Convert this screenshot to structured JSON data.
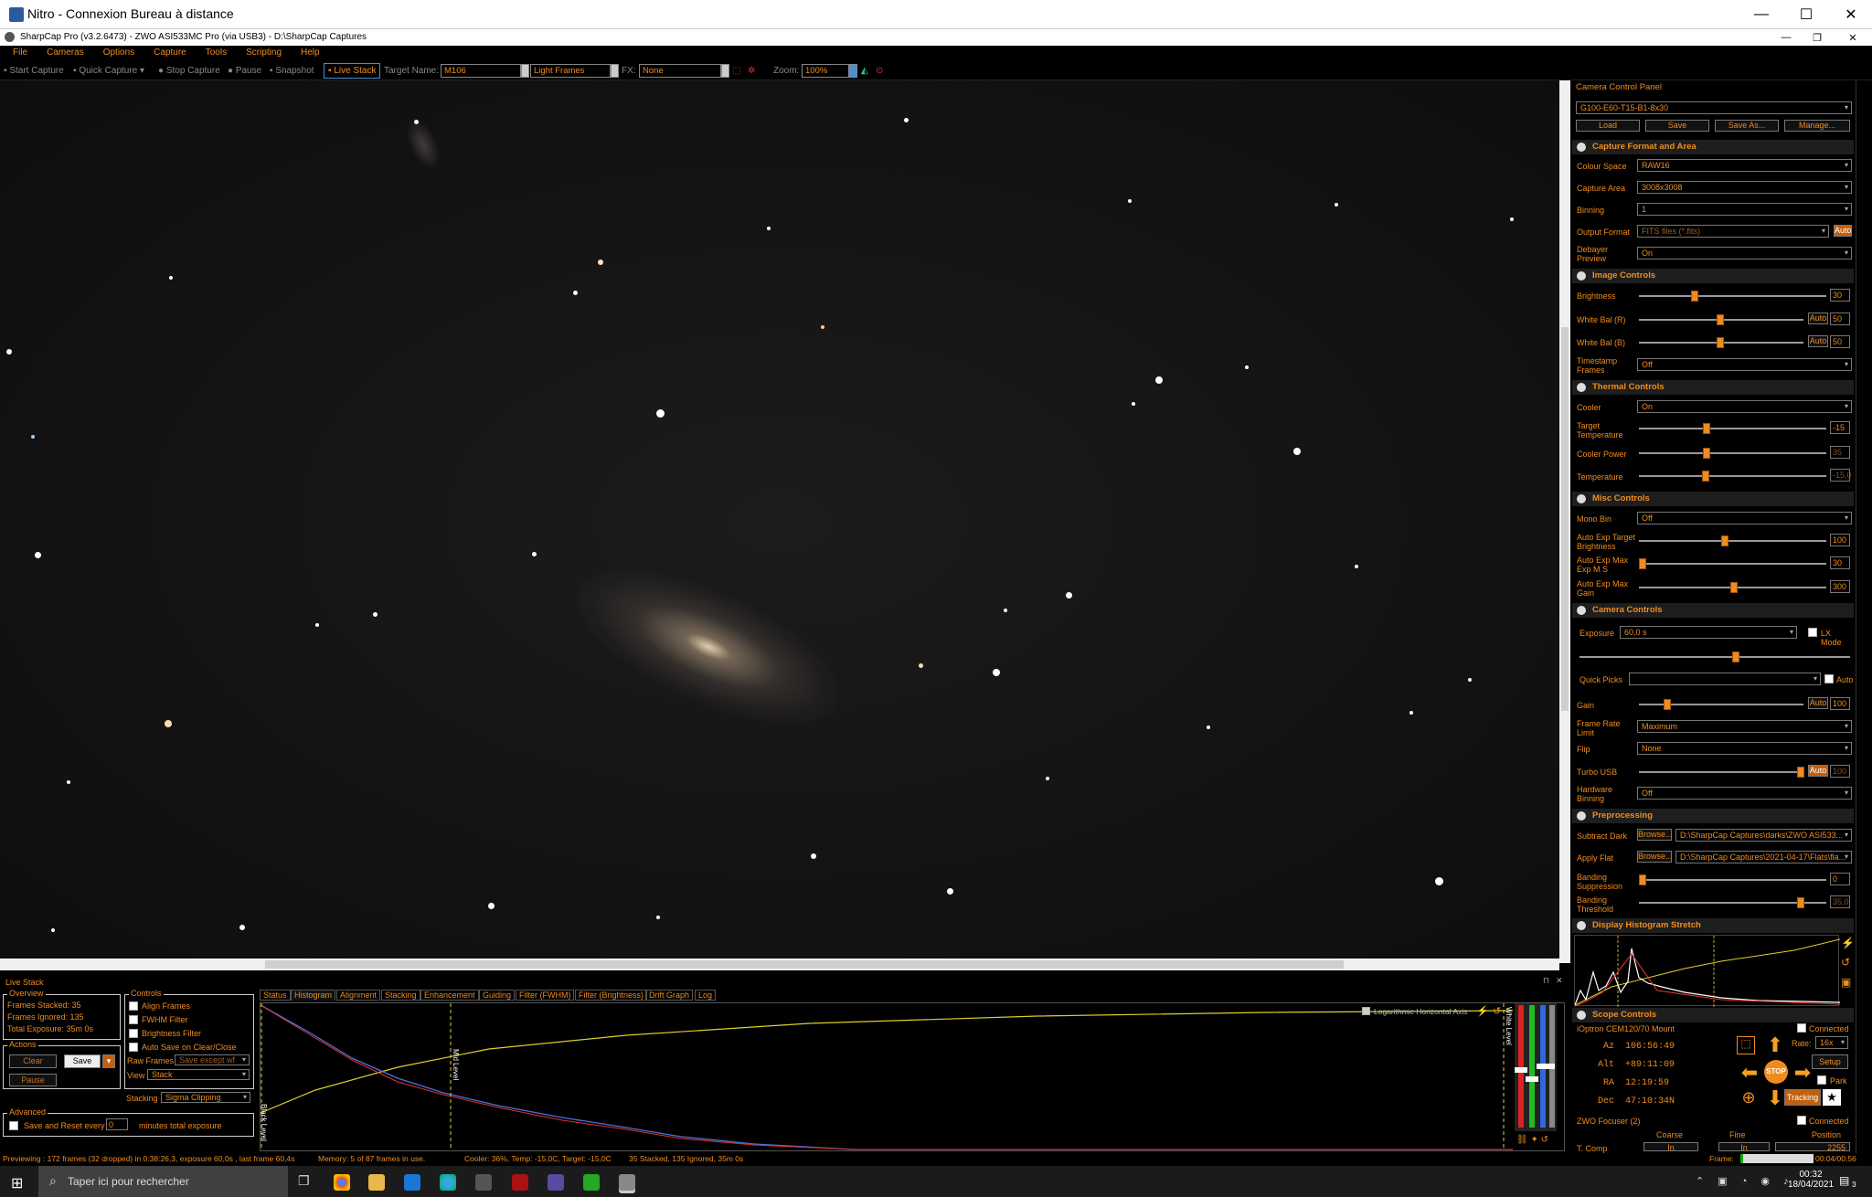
{
  "rdp": {
    "title": "Nitro - Connexion Bureau à distance",
    "min": "—",
    "max": "☐",
    "close": "✕"
  },
  "app": {
    "title": "SharpCap Pro (v3.2.6473) - ZWO ASI533MC Pro (via USB3) - D:\\SharpCap Captures"
  },
  "menu": [
    "File",
    "Cameras",
    "Options",
    "Capture",
    "Tools",
    "Scripting",
    "Help"
  ],
  "toolbar": {
    "start": "Start Capture",
    "quick": "Quick Capture",
    "stop": "Stop Capture",
    "pause": "Pause",
    "snapshot": "Snapshot",
    "live": "Live Stack",
    "target_label": "Target Name:",
    "target": "M106",
    "frames": "Light Frames",
    "fx_label": "FX:",
    "fx": "None",
    "zoom_label": "Zoom:",
    "zoom": "100%"
  },
  "panel": {
    "title": "Camera Control Panel",
    "profile": "G100-E60-T15-B1-8x30",
    "buttons": [
      "Load",
      "Save",
      "Save As...",
      "Manage..."
    ],
    "sections": {
      "capture_format": "Capture Format and Area",
      "image": "Image Controls",
      "thermal": "Thermal Controls",
      "misc": "Misc Controls",
      "camera": "Camera Controls",
      "pre": "Preprocessing",
      "hist": "Display Histogram Stretch",
      "scope": "Scope Controls"
    },
    "colour_space": {
      "label": "Colour Space",
      "value": "RAW16"
    },
    "capture_area": {
      "label": "Capture Area",
      "value": "3008x3008"
    },
    "binning": {
      "label": "Binning",
      "value": "1"
    },
    "output_format": {
      "label": "Output Format",
      "value": "FITS files (*.fits)",
      "auto": "Auto"
    },
    "debayer": {
      "label": "Debayer Preview",
      "value": "On"
    },
    "brightness": {
      "label": "Brightness",
      "value": "30"
    },
    "wb_r": {
      "label": "White Bal (R)",
      "value": "50",
      "auto": "Auto"
    },
    "wb_b": {
      "label": "White Bal (B)",
      "value": "50",
      "auto": "Auto"
    },
    "timestamp": {
      "label": "Timestamp Frames",
      "value": "Off"
    },
    "cooler": {
      "label": "Cooler",
      "value": "On"
    },
    "target_temp": {
      "label": "Target Temperature",
      "value": "-15"
    },
    "cooler_power": {
      "label": "Cooler Power",
      "value": "35"
    },
    "temperature": {
      "label": "Temperature",
      "value": "-15,0"
    },
    "mono_bin": {
      "label": "Mono Bin",
      "value": "Off"
    },
    "ae_target": {
      "label": "Auto Exp Target Brightness",
      "value": "100"
    },
    "ae_max_exp": {
      "label": "Auto Exp Max Exp M S",
      "value": "30"
    },
    "ae_max_gain": {
      "label": "Auto Exp Max Gain",
      "value": "300"
    },
    "exposure": {
      "label": "Exposure",
      "value": "60,0 s",
      "lx": "LX Mode"
    },
    "quick_picks": {
      "label": "Quick Picks",
      "auto": "Auto"
    },
    "gain": {
      "label": "Gain",
      "value": "100",
      "auto": "Auto"
    },
    "frame_rate": {
      "label": "Frame Rate Limit",
      "value": "Maximum"
    },
    "flip": {
      "label": "Flip",
      "value": "None"
    },
    "turbo": {
      "label": "Turbo USB",
      "value": "100",
      "auto": "Auto"
    },
    "hw_binning": {
      "label": "Hardware Binning",
      "value": "Off"
    },
    "subtract_dark": {
      "label": "Subtract Dark",
      "browse": "Browse...",
      "value": "D:\\SharpCap Captures\\darks\\ZWO ASI533..."
    },
    "apply_flat": {
      "label": "Apply Flat",
      "browse": "Browse...",
      "value": "D:\\SharpCap Captures\\2021-04-17\\Flats\\fla..."
    },
    "banding_supp": {
      "label": "Banding Suppression",
      "value": "0"
    },
    "banding_thr": {
      "label": "Banding Threshold",
      "value": "35,0"
    },
    "mount": {
      "name": "iOptron CEM120/70 Mount",
      "connected": "Connected",
      "az_label": "Az",
      "az": "106:56:49",
      "alt_label": "Alt",
      "alt": "+89:11:09",
      "ra_label": "RA",
      "ra": "12:19:59",
      "dec_label": "Dec",
      "dec": "47:10:34N",
      "rate_label": "Rate:",
      "rate": "16x",
      "setup": "Setup",
      "park": "Park",
      "tracking": "Tracking",
      "stop": "STOP"
    },
    "focuser": {
      "name": "ZWO Focuser (2)",
      "connected": "Connected",
      "coarse": "Coarse",
      "fine": "Fine",
      "position": "Position",
      "pos_val": "2255",
      "t_comp": "T. Comp",
      "in1": "In",
      "in2": "In"
    }
  },
  "live": {
    "title": "Live Stack",
    "overview": "Overview",
    "stacked": "Frames Stacked:  35",
    "ignored": "Frames Ignored:  135",
    "total": "Total Exposure:  35m 0s",
    "actions": "Actions",
    "clear": "Clear",
    "save": "Save",
    "pause": "Pause",
    "controls": "Controls",
    "align": "Align Frames",
    "fwhm": "FWHM Filter",
    "bright": "Brightness Filter",
    "autosave": "Auto Save on Clear/Close",
    "raw_label": "Raw Frames",
    "raw": "Save except wf",
    "view_label": "View",
    "view": "Stack",
    "stack_label": "Stacking",
    "stack": "Sigma Clipping",
    "advanced": "Advanced",
    "reset_label": "Save and Reset every",
    "reset_val": "0",
    "reset_suffix": "minutes total exposure",
    "tabs": [
      "Status",
      "Histogram",
      "Alignment",
      "Stacking",
      "Enhancement",
      "Guiding",
      "Filter (FWHM)",
      "Filter (Brightness)",
      "Drift Graph",
      "Log"
    ],
    "log_axis": "Logarithmic Horizontal Axis",
    "black": "Black Level",
    "mid": "Mid Level",
    "white": "White Level"
  },
  "status": {
    "preview": "Previewing : 172 frames (32 dropped) in 0:38:26,3, exposure 60,0s , last frame 60,4s",
    "memory": "Memory: 5 of 87 frames in use.",
    "cooler": "Cooler: 36%, Temp: -15,0C, Target: -15,0C",
    "stacked": "35 Stacked, 135 Ignored, 35m 0s",
    "frame_label": "Frame:",
    "time": "00:04/00:56"
  },
  "taskbar": {
    "search": "Taper ici pour rechercher",
    "time": "00:32",
    "date": "18/04/2021",
    "notif": "3"
  }
}
